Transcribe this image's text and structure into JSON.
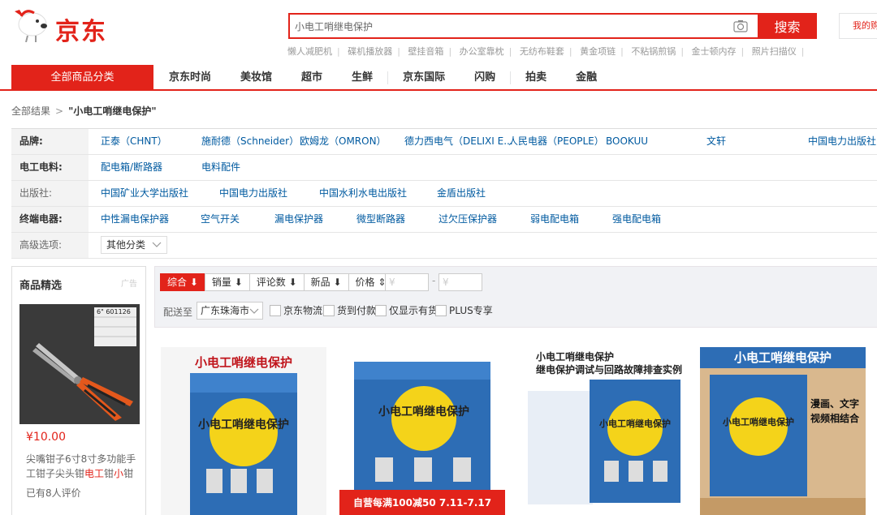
{
  "logo": {
    "text": "京东"
  },
  "search": {
    "value": "小电工哨继电保护",
    "button_label": "搜索"
  },
  "cart": {
    "label": "我的购物车"
  },
  "hotwords": [
    "懒人减肥机",
    "碟机播放器",
    "壁挂音箱",
    "办公室靠枕",
    "无纺布鞋套",
    "黄金项链",
    "不粘锅煎锅",
    "金士顿内存",
    "照片扫描仪"
  ],
  "nav": {
    "all_categories": "全部商品分类",
    "items": [
      "京东时尚",
      "美妆馆",
      "超市",
      "生鲜",
      "京东国际",
      "闪购",
      "拍卖",
      "金融"
    ]
  },
  "breadcrumb": {
    "all": "全部结果",
    "sep": ">",
    "query": "\"小电工哨继电保护\""
  },
  "filters": {
    "brand": {
      "label": "品牌:",
      "options": [
        "正泰（CHNT）",
        "施耐德（Schneider）",
        "欧姆龙（OMRON）",
        "德力西电气（DELIXI E...",
        "人民电器（PEOPLE）",
        "BOOKUU",
        "文轩",
        "中国电力出版社（"
      ]
    },
    "material": {
      "label": "电工电料:",
      "options": [
        "配电箱/断路器",
        "电料配件"
      ]
    },
    "publisher": {
      "label": "出版社:",
      "options": [
        "中国矿业大学出版社",
        "中国电力出版社",
        "中国水利水电出版社",
        "金盾出版社"
      ]
    },
    "terminal": {
      "label": "终端电器:",
      "options": [
        "中性漏电保护器",
        "空气开关",
        "漏电保护器",
        "微型断路器",
        "过欠压保护器",
        "弱电配电箱",
        "强电配电箱"
      ]
    },
    "advanced": {
      "label": "高级选项:",
      "select": "其他分类"
    }
  },
  "ad": {
    "title": "商品精选",
    "tag": "广告",
    "image_caption": "6\" 601126",
    "price": "¥10.00",
    "name_parts": [
      "尖嘴钳子6寸8寸多功能手工钳子尖头钳",
      "电工",
      "钳",
      "小",
      "钳"
    ],
    "reviews": "已有8人评价"
  },
  "sort": {
    "buttons": [
      "综合 ⬇",
      "销量 ⬇",
      "评论数 ⬇",
      "新品 ⬇",
      "价格 ⇕"
    ],
    "price_min_placeholder": "¥",
    "price_sep": "-",
    "price_max_placeholder": "¥",
    "deliver_label": "配送至",
    "deliver_value": "广东珠海市",
    "checkboxes": [
      "京东物流",
      "货到付款",
      "仅显示有货",
      "PLUS专享"
    ]
  },
  "products": [
    {
      "banner": "小电工哨继电保护",
      "cover_title": "小电工哨继电保护"
    },
    {
      "cover_title": "小电工哨继电保护",
      "promo": "自营每满100减50 7.11-7.17"
    },
    {
      "banner_line1": "小电工哨继电保护",
      "banner_line2": "继电保护调试与回路故障排查实例",
      "cover_title": "小电工哨继电保护"
    },
    {
      "banner": "小电工哨继电保护",
      "side_line1": "漫画、文字",
      "side_line2": "视频相结合",
      "cover_title": "小电工哨继电保护"
    }
  ],
  "colors": {
    "accent": "#e2231a",
    "link": "#005aa0",
    "book_blue": "#2d6db5",
    "book_yellow": "#f4d31a"
  }
}
